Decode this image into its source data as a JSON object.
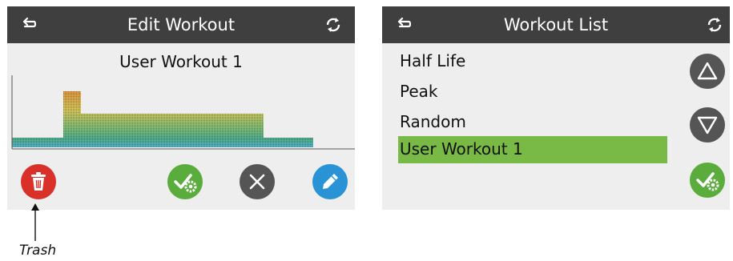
{
  "edit_screen": {
    "title": "Edit Workout",
    "workout_name": "User Workout 1",
    "back_icon": "back-arrow-icon",
    "refresh_icon": "refresh-icon",
    "buttons": [
      {
        "name": "trash-button",
        "icon": "trash-icon",
        "color": "#d9302a"
      },
      {
        "name": "save-settings-button",
        "icon": "check-gear-icon",
        "color": "#5aac3c"
      },
      {
        "name": "cancel-button",
        "icon": "close-icon",
        "color": "#555555"
      },
      {
        "name": "edit-button",
        "icon": "pencil-icon",
        "color": "#2a93d5"
      }
    ]
  },
  "list_screen": {
    "title": "Workout List",
    "back_icon": "back-arrow-icon",
    "refresh_icon": "refresh-icon",
    "items": [
      "Half Life",
      "Peak",
      "Random",
      "User Workout 1"
    ],
    "selected_index": 3,
    "selection_color": "#78ba45",
    "scroll_up_icon": "triangle-up-icon",
    "scroll_down_icon": "triangle-down-icon",
    "confirm_icon": "check-gear-icon"
  },
  "callout": {
    "label": "Trash"
  }
}
